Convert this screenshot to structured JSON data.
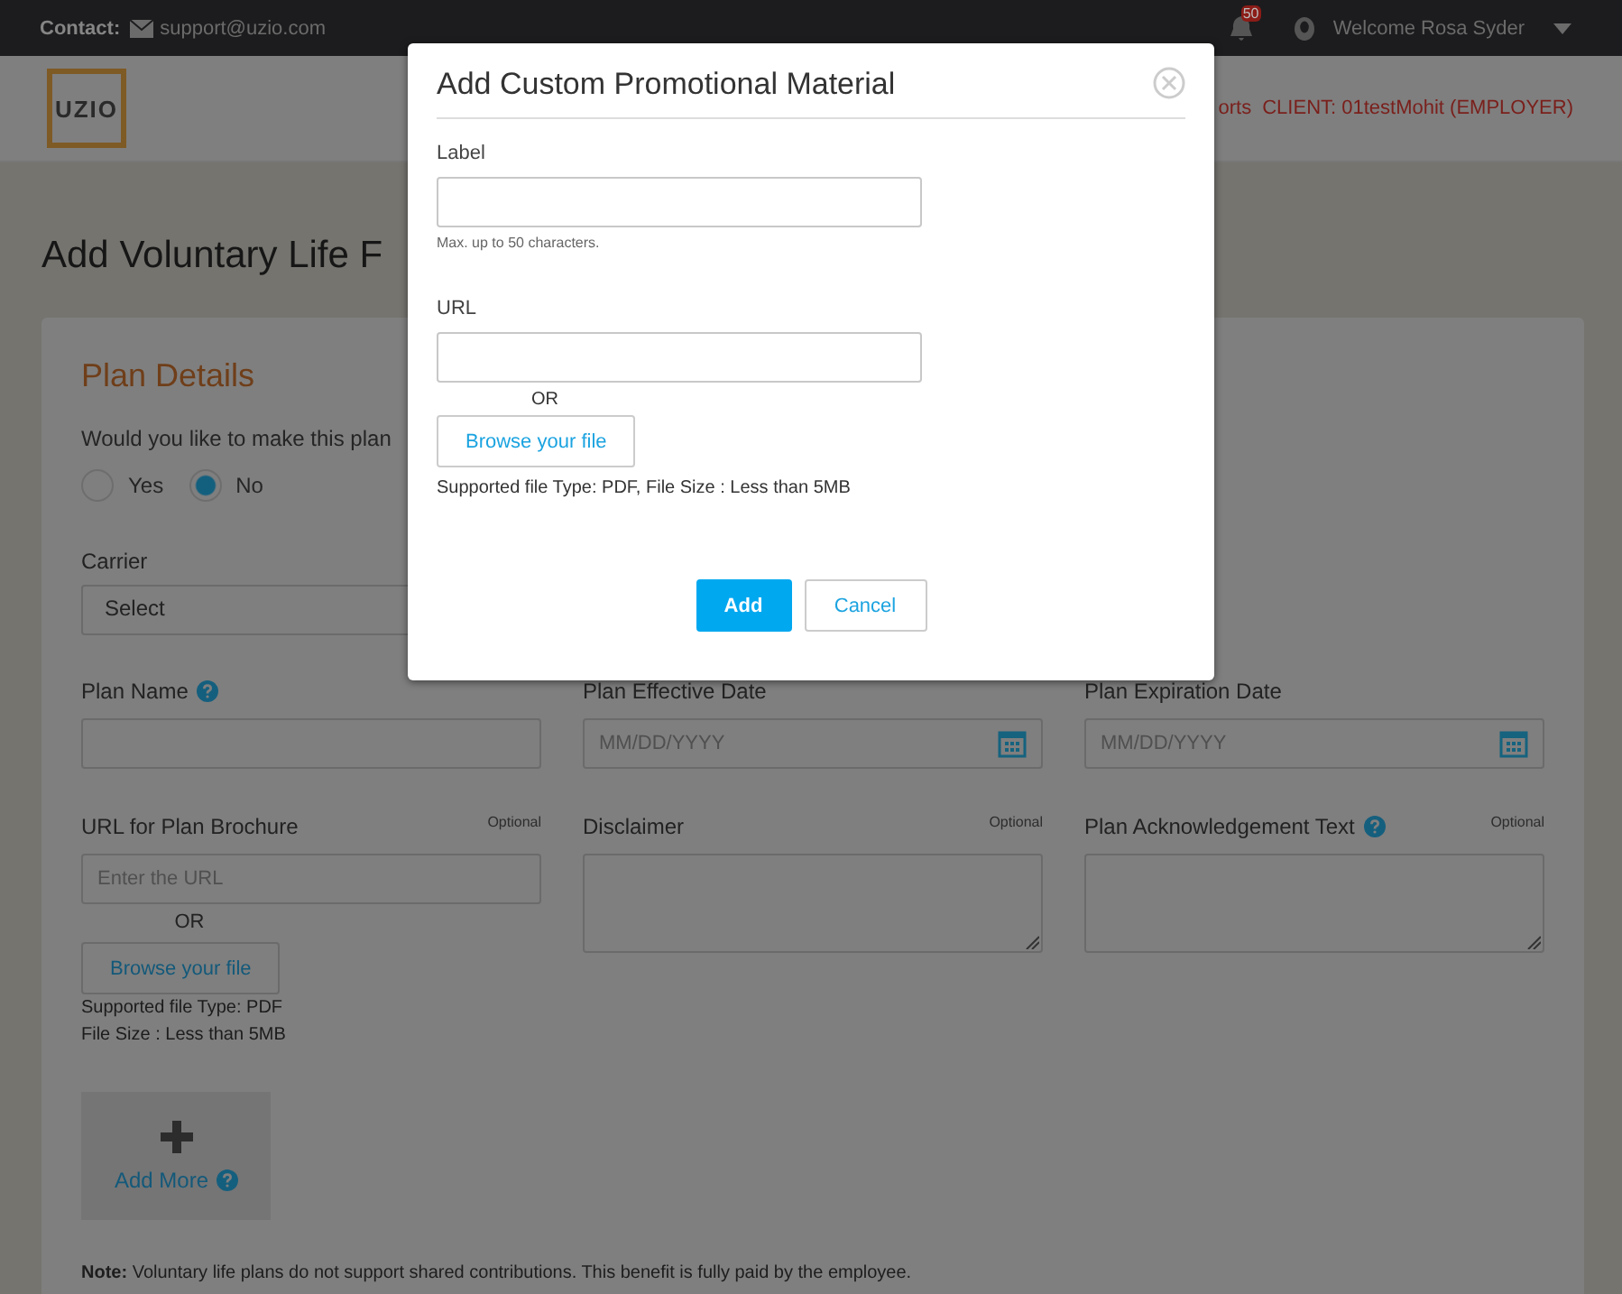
{
  "top_bar": {
    "contact_label": "Contact:",
    "email": "support@uzio.com",
    "notification_count": "50",
    "welcome": "Welcome Rosa Syder"
  },
  "header": {
    "logo": "UZIO",
    "nav": [
      {
        "label": "orts"
      },
      {
        "label": "CLIENT: 01testMohit (EMPLOYER)"
      }
    ]
  },
  "page_title": "Add Voluntary Life F",
  "plan_details": {
    "heading": "Plan Details",
    "question": "Would you like to make this plan",
    "options": [
      {
        "label": "Yes",
        "selected": false
      },
      {
        "label": "No",
        "selected": true
      }
    ],
    "carrier": {
      "label": "Carrier",
      "value": "Select"
    },
    "fields": [
      {
        "kind": "text",
        "label": "Plan Name",
        "help": true
      },
      {
        "kind": "date",
        "label": "Plan Effective Date",
        "placeholder": "MM/DD/YYYY"
      },
      {
        "kind": "date",
        "label": "Plan Expiration Date",
        "placeholder": "MM/DD/YYYY"
      },
      {
        "kind": "url",
        "label": "URL for Plan Brochure",
        "optional": "Optional",
        "placeholder": "Enter the URL",
        "or": "OR",
        "browse": "Browse your file",
        "notes": [
          "Supported file Type: PDF",
          "File Size : Less than 5MB"
        ]
      },
      {
        "kind": "textarea",
        "label": "Disclaimer",
        "optional": "Optional"
      },
      {
        "kind": "textarea",
        "label": "Plan Acknowledgement Text",
        "help": true,
        "optional": "Optional"
      }
    ],
    "add_more": {
      "label": "Add More",
      "help": true
    },
    "note": "**Note:** Voluntary life plans do not support shared contributions. This benefit is fully paid by the employee."
  },
  "modal": {
    "title": "Add Custom Promotional Material",
    "label_field": {
      "label": "Label",
      "hint": "Max. up to 50 characters."
    },
    "url_field": {
      "label": "URL"
    },
    "or": "OR",
    "browse": "Browse your file",
    "supported": "Supported file Type: PDF, File Size : Less than 5MB",
    "buttons": [
      {
        "label": "Add",
        "kind": "primary"
      },
      {
        "label": "Cancel",
        "kind": "secondary"
      }
    ]
  }
}
